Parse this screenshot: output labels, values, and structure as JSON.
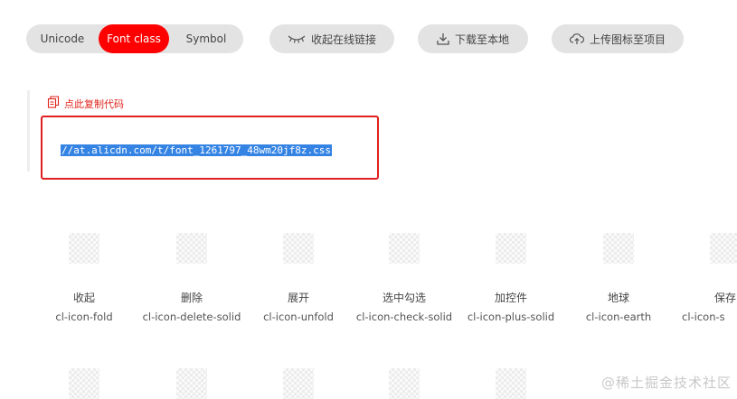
{
  "tabs": [
    {
      "label": "Unicode",
      "active": false
    },
    {
      "label": "Font class",
      "active": true
    },
    {
      "label": "Symbol",
      "active": false
    }
  ],
  "actions": {
    "collapse_link_label": "收起在线链接",
    "download_label": "下载至本地",
    "upload_label": "上传图标至项目"
  },
  "copy_code_label": "点此复制代码",
  "css_url": "//at.alicdn.com/t/font_1261797_48wm20jf8z.css",
  "icons": [
    {
      "name": "收起",
      "class": "cl-icon-fold"
    },
    {
      "name": "删除",
      "class": "cl-icon-delete-solid"
    },
    {
      "name": "展开",
      "class": "cl-icon-unfold"
    },
    {
      "name": "选中勾选",
      "class": "cl-icon-check-solid"
    },
    {
      "name": "加控件",
      "class": "cl-icon-plus-solid"
    },
    {
      "name": "地球",
      "class": "cl-icon-earth"
    },
    {
      "name": "保存",
      "class": "cl-icon-s"
    }
  ],
  "watermark": "@稀土掘金技术社区",
  "colors": {
    "accent": "#ff0000",
    "highlight": "#3584e4",
    "pill_bg": "#e3e3e3"
  }
}
